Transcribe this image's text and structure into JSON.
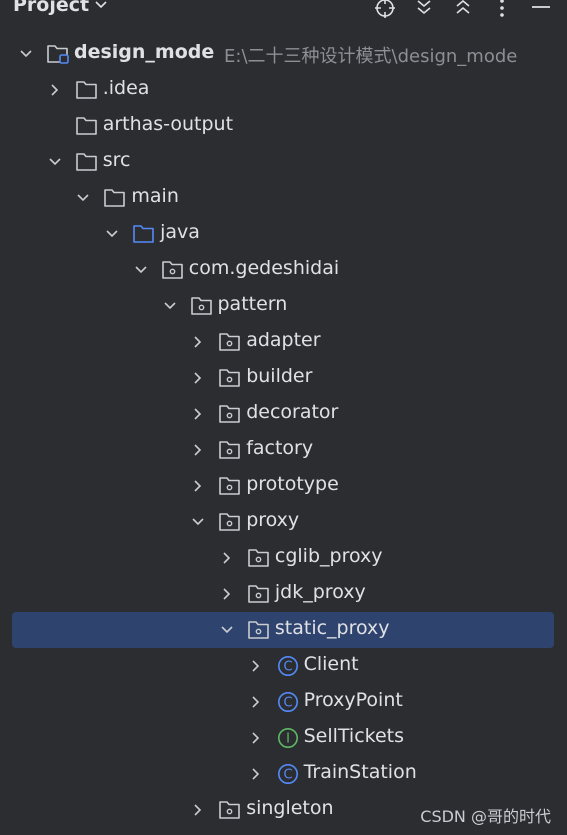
{
  "panel": {
    "title": "Project",
    "icons": [
      "locate-icon",
      "expand-all-icon",
      "collapse-all-icon",
      "more-icon",
      "minimize-icon"
    ]
  },
  "tree": [
    {
      "label": "design_mode",
      "path": "E:\\二十三种设计模式\\design_mode",
      "depth": 0,
      "chevron": "down",
      "icon": "module-folder"
    },
    {
      "label": ".idea",
      "depth": 1,
      "chevron": "right",
      "icon": "folder"
    },
    {
      "label": "arthas-output",
      "depth": 1,
      "chevron": "none",
      "icon": "folder"
    },
    {
      "label": "src",
      "depth": 1,
      "chevron": "down",
      "icon": "folder"
    },
    {
      "label": "main",
      "depth": 2,
      "chevron": "down",
      "icon": "folder"
    },
    {
      "label": "java",
      "depth": 3,
      "chevron": "down",
      "icon": "source-folder"
    },
    {
      "label": "com.gedeshidai",
      "depth": 4,
      "chevron": "down",
      "icon": "package"
    },
    {
      "label": "pattern",
      "depth": 5,
      "chevron": "down",
      "icon": "package"
    },
    {
      "label": "adapter",
      "depth": 6,
      "chevron": "right",
      "icon": "package"
    },
    {
      "label": "builder",
      "depth": 6,
      "chevron": "right",
      "icon": "package"
    },
    {
      "label": "decorator",
      "depth": 6,
      "chevron": "right",
      "icon": "package"
    },
    {
      "label": "factory",
      "depth": 6,
      "chevron": "right",
      "icon": "package"
    },
    {
      "label": "prototype",
      "depth": 6,
      "chevron": "right",
      "icon": "package"
    },
    {
      "label": "proxy",
      "depth": 6,
      "chevron": "down",
      "icon": "package"
    },
    {
      "label": "cglib_proxy",
      "depth": 7,
      "chevron": "right",
      "icon": "package"
    },
    {
      "label": "jdk_proxy",
      "depth": 7,
      "chevron": "right",
      "icon": "package"
    },
    {
      "label": "static_proxy",
      "depth": 7,
      "chevron": "down",
      "icon": "package",
      "selected": true
    },
    {
      "label": "Client",
      "depth": 8,
      "chevron": "right",
      "icon": "class"
    },
    {
      "label": "ProxyPoint",
      "depth": 8,
      "chevron": "right",
      "icon": "class"
    },
    {
      "label": "SellTickets",
      "depth": 8,
      "chevron": "right",
      "icon": "interface"
    },
    {
      "label": "TrainStation",
      "depth": 8,
      "chevron": "right",
      "icon": "class"
    },
    {
      "label": "singleton",
      "depth": 6,
      "chevron": "right",
      "icon": "package"
    }
  ],
  "watermark": "CSDN @哥的时代",
  "colors": {
    "background": "#2b2d30",
    "selection": "#2e436e",
    "text": "#dfe1e5",
    "path_text": "#8c8f94",
    "class_icon": "#548af7",
    "interface_icon": "#5fb865",
    "source_folder": "#548af7"
  }
}
